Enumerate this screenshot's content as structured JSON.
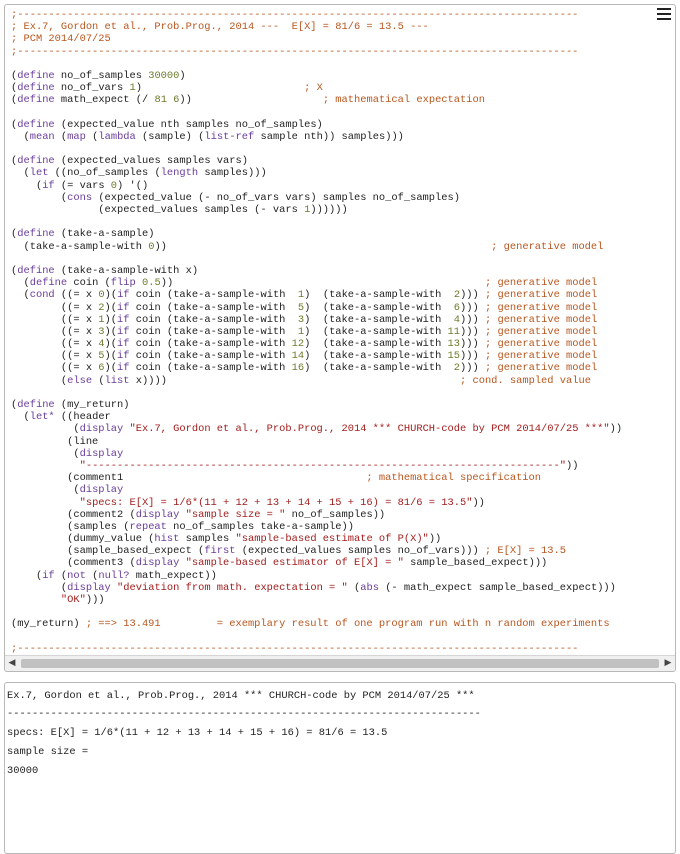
{
  "editor": {
    "menu_icon": "hamburger-menu-icon",
    "scroll_left_icon": "◀",
    "scroll_right_icon": "▶",
    "lines": [
      [
        {
          "t": ";------------------------------------------------------------------------------------------",
          "c": "cm"
        }
      ],
      [
        {
          "t": "; Ex.7, Gordon et al., Prob.Prog., 2014 ---  E[X] = 81/6 = 13.5 ---",
          "c": "cm"
        }
      ],
      [
        {
          "t": "; PCM 2014/07/25",
          "c": "cm"
        }
      ],
      [
        {
          "t": ";------------------------------------------------------------------------------------------",
          "c": "cm"
        }
      ],
      [],
      [
        {
          "t": "(",
          "c": ""
        },
        {
          "t": "define",
          "c": "kw"
        },
        {
          "t": " no_of_samples ",
          "c": ""
        },
        {
          "t": "30000",
          "c": "nm"
        },
        {
          "t": ")",
          "c": ""
        }
      ],
      [
        {
          "t": "(",
          "c": ""
        },
        {
          "t": "define",
          "c": "kw"
        },
        {
          "t": " no_of_vars ",
          "c": ""
        },
        {
          "t": "1",
          "c": "nm"
        },
        {
          "t": ")                          ",
          "c": ""
        },
        {
          "t": "; X",
          "c": "cm"
        }
      ],
      [
        {
          "t": "(",
          "c": ""
        },
        {
          "t": "define",
          "c": "kw"
        },
        {
          "t": " math_expect (/ ",
          "c": ""
        },
        {
          "t": "81 6",
          "c": "nm"
        },
        {
          "t": "))                     ",
          "c": ""
        },
        {
          "t": "; mathematical expectation",
          "c": "cm"
        }
      ],
      [],
      [
        {
          "t": "(",
          "c": ""
        },
        {
          "t": "define",
          "c": "kw"
        },
        {
          "t": " (expected_value nth samples no_of_samples)",
          "c": ""
        }
      ],
      [
        {
          "t": "  (",
          "c": ""
        },
        {
          "t": "mean",
          "c": "kw"
        },
        {
          "t": " (",
          "c": ""
        },
        {
          "t": "map",
          "c": "kw"
        },
        {
          "t": " (",
          "c": ""
        },
        {
          "t": "lambda",
          "c": "kw"
        },
        {
          "t": " (sample) (",
          "c": ""
        },
        {
          "t": "list-ref",
          "c": "kw"
        },
        {
          "t": " sample nth)) samples)))",
          "c": ""
        }
      ],
      [],
      [
        {
          "t": "(",
          "c": ""
        },
        {
          "t": "define",
          "c": "kw"
        },
        {
          "t": " (expected_values samples vars)",
          "c": ""
        }
      ],
      [
        {
          "t": "  (",
          "c": ""
        },
        {
          "t": "let",
          "c": "kw"
        },
        {
          "t": " ((no_of_samples (",
          "c": ""
        },
        {
          "t": "length",
          "c": "kw"
        },
        {
          "t": " samples)))",
          "c": ""
        }
      ],
      [
        {
          "t": "    (",
          "c": ""
        },
        {
          "t": "if",
          "c": "kw"
        },
        {
          "t": " (= vars ",
          "c": ""
        },
        {
          "t": "0",
          "c": "nm"
        },
        {
          "t": ") '()",
          "c": ""
        }
      ],
      [
        {
          "t": "        (",
          "c": ""
        },
        {
          "t": "cons",
          "c": "kw"
        },
        {
          "t": " (expected_value (- no_of_vars vars) samples no_of_samples)",
          "c": ""
        }
      ],
      [
        {
          "t": "              (expected_values samples (- vars ",
          "c": ""
        },
        {
          "t": "1",
          "c": "nm"
        },
        {
          "t": "))))))",
          "c": ""
        }
      ],
      [],
      [
        {
          "t": "(",
          "c": ""
        },
        {
          "t": "define",
          "c": "kw"
        },
        {
          "t": " (take-a-sample)",
          "c": ""
        }
      ],
      [
        {
          "t": "  (take-a-sample-with ",
          "c": ""
        },
        {
          "t": "0",
          "c": "nm"
        },
        {
          "t": "))                                                    ",
          "c": ""
        },
        {
          "t": "; generative model",
          "c": "cm"
        }
      ],
      [],
      [
        {
          "t": "(",
          "c": ""
        },
        {
          "t": "define",
          "c": "kw"
        },
        {
          "t": " (take-a-sample-with x)",
          "c": ""
        }
      ],
      [
        {
          "t": "  (",
          "c": ""
        },
        {
          "t": "define",
          "c": "kw"
        },
        {
          "t": " coin (",
          "c": ""
        },
        {
          "t": "flip",
          "c": "kw"
        },
        {
          "t": " ",
          "c": ""
        },
        {
          "t": "0.5",
          "c": "nm"
        },
        {
          "t": "))                                                  ",
          "c": ""
        },
        {
          "t": "; generative model",
          "c": "cm"
        }
      ],
      [
        {
          "t": "  (",
          "c": ""
        },
        {
          "t": "cond",
          "c": "kw"
        },
        {
          "t": " ((= x ",
          "c": ""
        },
        {
          "t": "0",
          "c": "nm"
        },
        {
          "t": ")(",
          "c": ""
        },
        {
          "t": "if",
          "c": "kw"
        },
        {
          "t": " coin (take-a-sample-with  ",
          "c": ""
        },
        {
          "t": "1",
          "c": "nm"
        },
        {
          "t": ")  (take-a-sample-with  ",
          "c": ""
        },
        {
          "t": "2",
          "c": "nm"
        },
        {
          "t": "))) ",
          "c": ""
        },
        {
          "t": "; generative model",
          "c": "cm"
        }
      ],
      [
        {
          "t": "        ((= x ",
          "c": ""
        },
        {
          "t": "2",
          "c": "nm"
        },
        {
          "t": ")(",
          "c": ""
        },
        {
          "t": "if",
          "c": "kw"
        },
        {
          "t": " coin (take-a-sample-with  ",
          "c": ""
        },
        {
          "t": "5",
          "c": "nm"
        },
        {
          "t": ")  (take-a-sample-with  ",
          "c": ""
        },
        {
          "t": "6",
          "c": "nm"
        },
        {
          "t": "))) ",
          "c": ""
        },
        {
          "t": "; generative model",
          "c": "cm"
        }
      ],
      [
        {
          "t": "        ((= x ",
          "c": ""
        },
        {
          "t": "1",
          "c": "nm"
        },
        {
          "t": ")(",
          "c": ""
        },
        {
          "t": "if",
          "c": "kw"
        },
        {
          "t": " coin (take-a-sample-with  ",
          "c": ""
        },
        {
          "t": "3",
          "c": "nm"
        },
        {
          "t": ")  (take-a-sample-with  ",
          "c": ""
        },
        {
          "t": "4",
          "c": "nm"
        },
        {
          "t": "))) ",
          "c": ""
        },
        {
          "t": "; generative model",
          "c": "cm"
        }
      ],
      [
        {
          "t": "        ((= x ",
          "c": ""
        },
        {
          "t": "3",
          "c": "nm"
        },
        {
          "t": ")(",
          "c": ""
        },
        {
          "t": "if",
          "c": "kw"
        },
        {
          "t": " coin (take-a-sample-with  ",
          "c": ""
        },
        {
          "t": "1",
          "c": "nm"
        },
        {
          "t": ")  (take-a-sample-with ",
          "c": ""
        },
        {
          "t": "11",
          "c": "nm"
        },
        {
          "t": "))) ",
          "c": ""
        },
        {
          "t": "; generative model",
          "c": "cm"
        }
      ],
      [
        {
          "t": "        ((= x ",
          "c": ""
        },
        {
          "t": "4",
          "c": "nm"
        },
        {
          "t": ")(",
          "c": ""
        },
        {
          "t": "if",
          "c": "kw"
        },
        {
          "t": " coin (take-a-sample-with ",
          "c": ""
        },
        {
          "t": "12",
          "c": "nm"
        },
        {
          "t": ")  (take-a-sample-with ",
          "c": ""
        },
        {
          "t": "13",
          "c": "nm"
        },
        {
          "t": "))) ",
          "c": ""
        },
        {
          "t": "; generative model",
          "c": "cm"
        }
      ],
      [
        {
          "t": "        ((= x ",
          "c": ""
        },
        {
          "t": "5",
          "c": "nm"
        },
        {
          "t": ")(",
          "c": ""
        },
        {
          "t": "if",
          "c": "kw"
        },
        {
          "t": " coin (take-a-sample-with ",
          "c": ""
        },
        {
          "t": "14",
          "c": "nm"
        },
        {
          "t": ")  (take-a-sample-with ",
          "c": ""
        },
        {
          "t": "15",
          "c": "nm"
        },
        {
          "t": "))) ",
          "c": ""
        },
        {
          "t": "; generative model",
          "c": "cm"
        }
      ],
      [
        {
          "t": "        ((= x ",
          "c": ""
        },
        {
          "t": "6",
          "c": "nm"
        },
        {
          "t": ")(",
          "c": ""
        },
        {
          "t": "if",
          "c": "kw"
        },
        {
          "t": " coin (take-a-sample-with ",
          "c": ""
        },
        {
          "t": "16",
          "c": "nm"
        },
        {
          "t": ")  (take-a-sample-with  ",
          "c": ""
        },
        {
          "t": "2",
          "c": "nm"
        },
        {
          "t": "))) ",
          "c": ""
        },
        {
          "t": "; generative model",
          "c": "cm"
        }
      ],
      [
        {
          "t": "        (",
          "c": ""
        },
        {
          "t": "else",
          "c": "kw"
        },
        {
          "t": " (",
          "c": ""
        },
        {
          "t": "list",
          "c": "kw"
        },
        {
          "t": " x))))                                               ",
          "c": ""
        },
        {
          "t": "; cond. sampled value",
          "c": "cm"
        }
      ],
      [],
      [
        {
          "t": "(",
          "c": ""
        },
        {
          "t": "define",
          "c": "kw"
        },
        {
          "t": " (my_return)",
          "c": ""
        }
      ],
      [
        {
          "t": "  (",
          "c": ""
        },
        {
          "t": "let*",
          "c": "kw"
        },
        {
          "t": " ((header",
          "c": ""
        }
      ],
      [
        {
          "t": "          (",
          "c": ""
        },
        {
          "t": "display",
          "c": "kw"
        },
        {
          "t": " ",
          "c": ""
        },
        {
          "t": "\"Ex.7, Gordon et al., Prob.Prog., 2014 *** CHURCH-code by PCM 2014/07/25 ***\"",
          "c": "st"
        },
        {
          "t": "))",
          "c": ""
        }
      ],
      [
        {
          "t": "         (line",
          "c": ""
        }
      ],
      [
        {
          "t": "          (",
          "c": ""
        },
        {
          "t": "display",
          "c": "kw"
        }
      ],
      [
        {
          "t": "           ",
          "c": ""
        },
        {
          "t": "\"----------------------------------------------------------------------------\"",
          "c": "st"
        },
        {
          "t": "))",
          "c": ""
        }
      ],
      [
        {
          "t": "         (comment1                                       ",
          "c": ""
        },
        {
          "t": "; mathematical specification",
          "c": "cm"
        }
      ],
      [
        {
          "t": "          (",
          "c": ""
        },
        {
          "t": "display",
          "c": "kw"
        }
      ],
      [
        {
          "t": "           ",
          "c": ""
        },
        {
          "t": "\"specs: E[X] = 1/6*(11 + 12 + 13 + 14 + 15 + 16) = 81/6 = 13.5\"",
          "c": "st"
        },
        {
          "t": "))",
          "c": ""
        }
      ],
      [
        {
          "t": "         (comment2 (",
          "c": ""
        },
        {
          "t": "display",
          "c": "kw"
        },
        {
          "t": " ",
          "c": ""
        },
        {
          "t": "\"sample size = \"",
          "c": "st"
        },
        {
          "t": " no_of_samples))",
          "c": ""
        }
      ],
      [
        {
          "t": "         (samples (",
          "c": ""
        },
        {
          "t": "repeat",
          "c": "kw"
        },
        {
          "t": " no_of_samples take-a-sample))",
          "c": ""
        }
      ],
      [
        {
          "t": "         (dummy_value (",
          "c": ""
        },
        {
          "t": "hist",
          "c": "kw"
        },
        {
          "t": " samples ",
          "c": ""
        },
        {
          "t": "\"sample-based estimate of P(X)\"",
          "c": "st"
        },
        {
          "t": "))",
          "c": ""
        }
      ],
      [
        {
          "t": "         (sample_based_expect (",
          "c": ""
        },
        {
          "t": "first",
          "c": "kw"
        },
        {
          "t": " (expected_values samples no_of_vars))) ",
          "c": ""
        },
        {
          "t": "; E[X] = 13.5",
          "c": "cm"
        }
      ],
      [
        {
          "t": "         (comment3 (",
          "c": ""
        },
        {
          "t": "display",
          "c": "kw"
        },
        {
          "t": " ",
          "c": ""
        },
        {
          "t": "\"sample-based estimator of E[X] = \"",
          "c": "st"
        },
        {
          "t": " sample_based_expect)))",
          "c": ""
        }
      ],
      [
        {
          "t": "    (",
          "c": ""
        },
        {
          "t": "if",
          "c": "kw"
        },
        {
          "t": " (",
          "c": ""
        },
        {
          "t": "not",
          "c": "kw"
        },
        {
          "t": " (",
          "c": ""
        },
        {
          "t": "null?",
          "c": "kw"
        },
        {
          "t": " math_expect))",
          "c": ""
        }
      ],
      [
        {
          "t": "        (",
          "c": ""
        },
        {
          "t": "display",
          "c": "kw"
        },
        {
          "t": " ",
          "c": ""
        },
        {
          "t": "\"deviation from math. expectation = \"",
          "c": "st"
        },
        {
          "t": " (",
          "c": ""
        },
        {
          "t": "abs",
          "c": "kw"
        },
        {
          "t": " (- math_expect sample_based_expect)))",
          "c": ""
        }
      ],
      [
        {
          "t": "        ",
          "c": ""
        },
        {
          "t": "\"OK\"",
          "c": "st"
        },
        {
          "t": ")))",
          "c": ""
        }
      ],
      [],
      [
        {
          "t": "(my_return) ",
          "c": ""
        },
        {
          "t": "; ==> 13.491         = exemplary result of one program run with n random experiments",
          "c": "cm"
        }
      ],
      [],
      [
        {
          "t": ";------------------------------------------------------------------------------------------",
          "c": "cm"
        }
      ]
    ]
  },
  "output": {
    "lines": [
      "Ex.7, Gordon et al., Prob.Prog., 2014 *** CHURCH-code by PCM 2014/07/25 ***",
      "----------------------------------------------------------------------------",
      "specs: E[X] = 1/6*(11 + 12 + 13 + 14 + 15 + 16) = 81/6 = 13.5",
      "sample size =",
      "30000"
    ]
  }
}
